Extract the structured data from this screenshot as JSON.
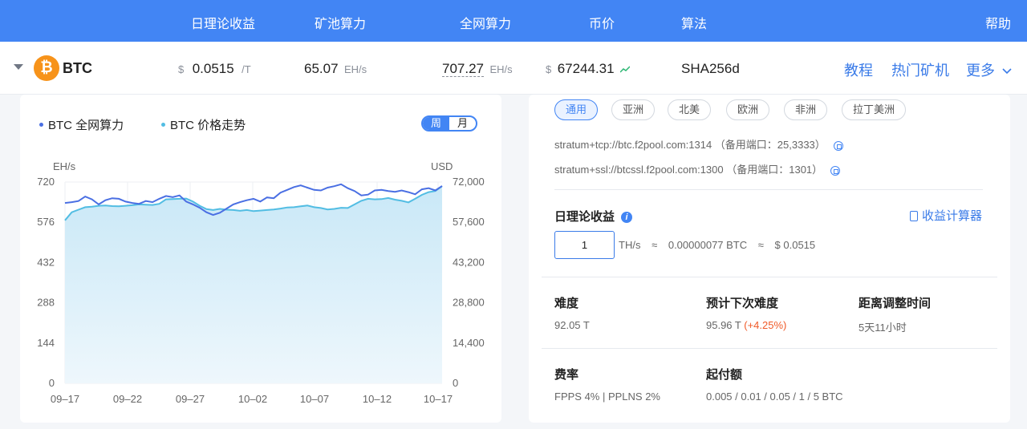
{
  "header": {
    "daily_revenue": "日理论收益",
    "pool_hashrate": "矿池算力",
    "network_hashrate": "全网算力",
    "price": "币价",
    "algorithm": "算法",
    "help": "帮助"
  },
  "coin_row": {
    "coin_icon": "bitcoin-icon",
    "coin_symbol": "₿",
    "coin": "BTC",
    "revenue_currency": "$",
    "revenue_value": "0.0515",
    "revenue_unit": "/T",
    "pool_hashrate_value": "65.07",
    "pool_hashrate_unit": "EH/s",
    "network_hashrate_value": "707.27",
    "network_hashrate_unit": "EH/s",
    "price_currency": "$",
    "price_value": "67244.31",
    "price_trend_icon": "trend-up-icon",
    "algorithm_value": "SHA256d",
    "tutorial": "教程",
    "hot_miners": "热门矿机",
    "more": "更多"
  },
  "chart_panel": {
    "legend_hashrate": "BTC 全网算力",
    "legend_price": "BTC 价格走势",
    "toggle_week": "周",
    "toggle_month": "月"
  },
  "chart_data": {
    "type": "line",
    "left_unit": "EH/s",
    "right_unit": "USD",
    "left_ticks": [
      "720",
      "576",
      "432",
      "288",
      "144",
      "0"
    ],
    "right_ticks": [
      "72,000",
      "57,600",
      "43,200",
      "28,800",
      "14,400",
      "0"
    ],
    "x_ticks": [
      "09–17",
      "09–22",
      "09–27",
      "10–02",
      "10–07",
      "10–12",
      "10–17"
    ],
    "ylim_left": [
      0,
      720
    ],
    "ylim_right": [
      0,
      72000
    ],
    "grid": true,
    "colors": {
      "hashrate": "#4a6fe3",
      "price": "#52bde3"
    },
    "series": [
      {
        "name": "BTC 全网算力",
        "axis": "left",
        "values": [
          645,
          648,
          652,
          668,
          658,
          640,
          655,
          662,
          660,
          650,
          645,
          642,
          652,
          648,
          660,
          670,
          666,
          672,
          650,
          640,
          628,
          612,
          602,
          610,
          625,
          640,
          648,
          655,
          660,
          650,
          665,
          662,
          682,
          692,
          702,
          708,
          700,
          692,
          690,
          700,
          705,
          712,
          698,
          688,
          672,
          675,
          690,
          692,
          688,
          685,
          690,
          684,
          676,
          694,
          698,
          690,
          706
        ]
      },
      {
        "name": "BTC 价格走势",
        "axis": "right",
        "values": [
          58300,
          61200,
          62100,
          63000,
          63200,
          63500,
          63600,
          63400,
          63300,
          63500,
          63700,
          64000,
          63900,
          63800,
          64200,
          65800,
          65900,
          66000,
          66100,
          65000,
          63500,
          62300,
          62000,
          62400,
          62100,
          62000,
          61700,
          62000,
          61600,
          61800,
          62000,
          62200,
          62500,
          62900,
          63000,
          63300,
          63600,
          63000,
          62700,
          62200,
          62400,
          62800,
          62700,
          64000,
          65300,
          66000,
          65800,
          65900,
          66300,
          65700,
          65300,
          64700,
          66000,
          67400,
          68400,
          68800,
          70500
        ]
      }
    ]
  },
  "regions": [
    "通用",
    "亚洲",
    "北美",
    "欧洲",
    "非洲",
    "拉丁美洲"
  ],
  "stratum": {
    "tcp": "stratum+tcp://btc.f2pool.com:1314 （备用端口：25,3333）",
    "ssl": "stratum+ssl://btcssl.f2pool.com:1300 （备用端口：1301）",
    "copy_icon": "copy-icon"
  },
  "revenue_calc": {
    "title": "日理论收益",
    "info_icon": "info-icon",
    "info_glyph": "i",
    "calculator_icon": "calculator-icon",
    "calculator_link": "收益计算器",
    "input_value": "1",
    "input_unit": "TH/s",
    "approx1": "≈",
    "btc_amount": "0.00000077  BTC",
    "approx2": "≈",
    "usd_amount": "$ 0.0515"
  },
  "stats": {
    "difficulty_label": "难度",
    "difficulty_value": "92.05 T",
    "next_difficulty_label": "预计下次难度",
    "next_difficulty_value": "95.96 T",
    "next_difficulty_change": "(+4.25%)",
    "adjust_time_label": "距离调整时间",
    "adjust_time_value": "5天11小时",
    "fee_label": "费率",
    "fee_value": "FPPS 4% | PPLNS 2%",
    "min_payout_label": "起付额",
    "min_payout_value": "0.005 / 0.01 / 0.05 / 1 / 5  BTC"
  }
}
